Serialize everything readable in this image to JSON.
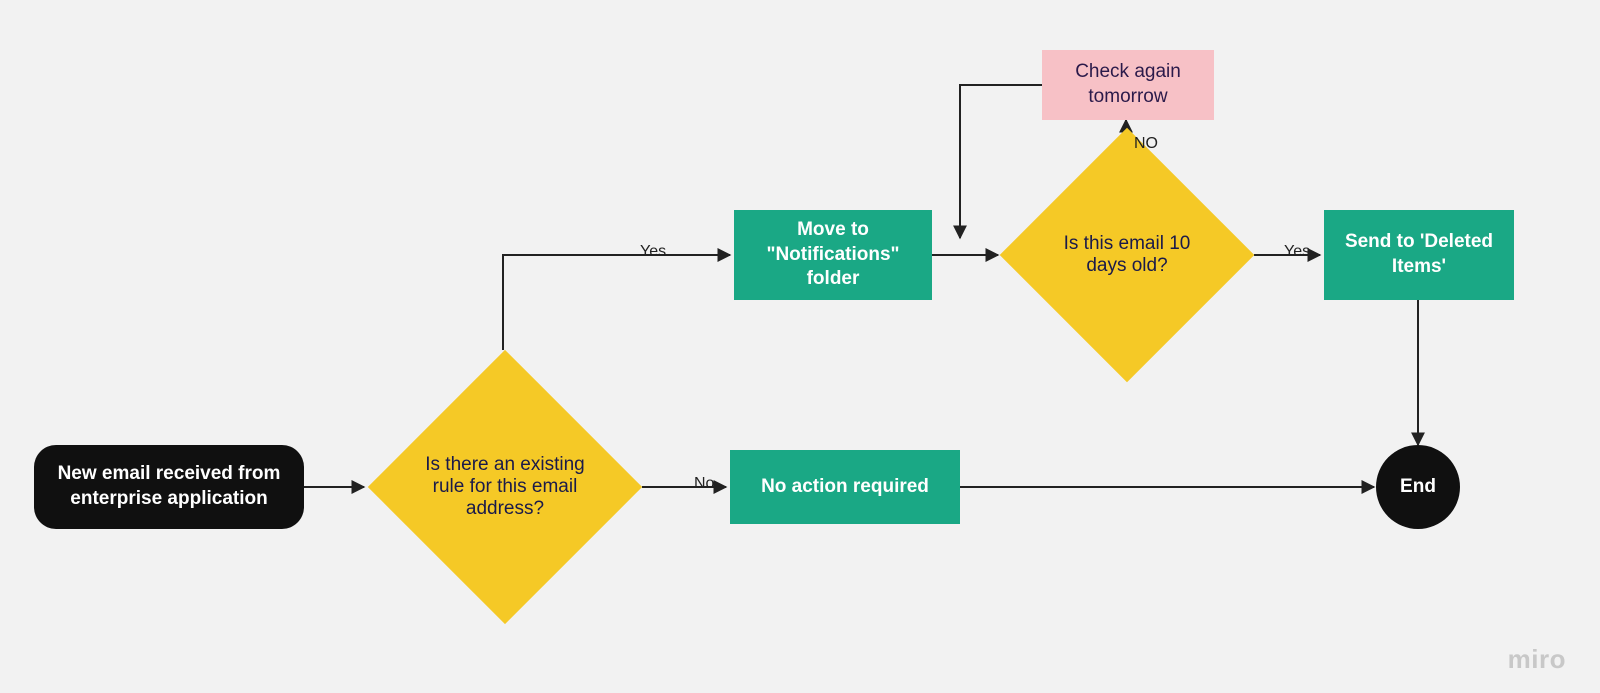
{
  "nodes": {
    "start": {
      "text": "New email received from enterprise application"
    },
    "decision1": {
      "text": "Is there an existing rule for this email address?"
    },
    "move_notifications": {
      "text": "Move to \"Notifications\" folder"
    },
    "decision2": {
      "text": "Is this email 10 days old?"
    },
    "check_tomorrow": {
      "text": "Check again tomorrow"
    },
    "send_deleted": {
      "text": "Send to 'Deleted Items'"
    },
    "no_action": {
      "text": "No action required"
    },
    "end": {
      "text": "End"
    }
  },
  "edges": {
    "d1_yes": {
      "label": "Yes"
    },
    "d1_no": {
      "label": "No"
    },
    "d2_yes": {
      "label": "Yes"
    },
    "d2_no": {
      "label": "NO"
    }
  },
  "watermark": "miro"
}
